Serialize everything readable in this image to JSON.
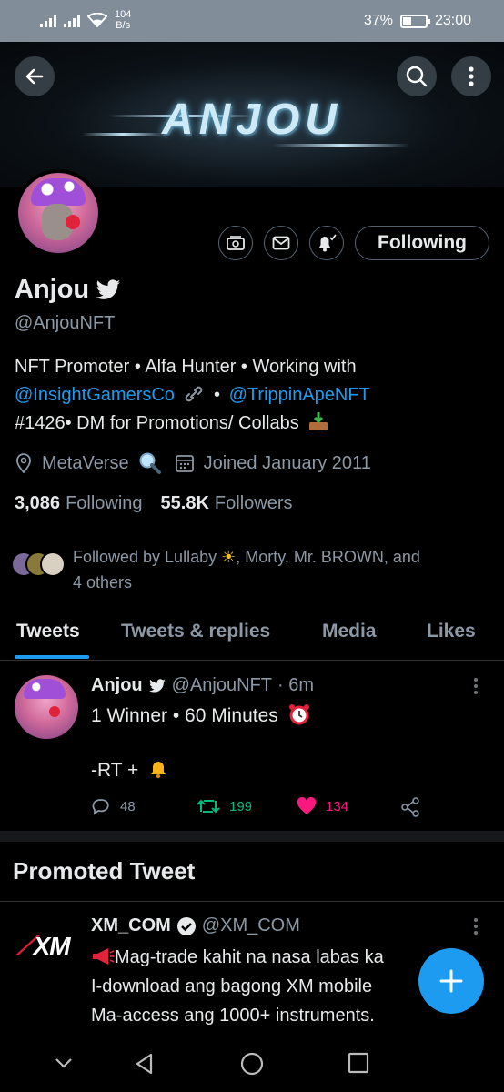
{
  "status_bar": {
    "speed_value": "104",
    "speed_unit": "B/s",
    "battery": "37%",
    "battery_level": 0.37,
    "time": "23:00"
  },
  "banner": {
    "logo_text": "ANJOU"
  },
  "profile": {
    "name": "Anjou",
    "handle": "@AnjouNFT",
    "following_button": "Following",
    "bio_line1": "NFT Promoter • Alfa Hunter • Working with",
    "bio_link1": "@InsightGamersCo",
    "bio_sep": "•",
    "bio_link2": "@TrippinApeNFT",
    "bio_line3": "#1426• DM for Promotions/ Collabs",
    "location": "MetaVerse",
    "joined": "Joined January 2011",
    "following_count": "3,086",
    "following_label": "Following",
    "followers_count": "55.8K",
    "followers_label": "Followers",
    "followed_by_1": "Followed by Lullaby",
    "followed_by_2": ", Morty, Mr. BROWN, and",
    "followed_by_3": "4 others"
  },
  "tabs": [
    {
      "label": "Tweets",
      "active": true
    },
    {
      "label": "Tweets & replies",
      "active": false
    },
    {
      "label": "Media",
      "active": false
    },
    {
      "label": "Likes",
      "active": false
    }
  ],
  "tweet": {
    "name": "Anjou",
    "handle": "@AnjouNFT",
    "time": "· 6m",
    "line1": "1 Winner • 60 Minutes",
    "line2": "-RT +",
    "replies": "48",
    "retweets": "199",
    "likes": "134"
  },
  "promoted": {
    "title": "Promoted Tweet",
    "logo": "XM",
    "name": "XM_COM",
    "handle": "@XM_COM",
    "line1": "Mag-trade kahit na nasa labas ka",
    "line2": "I-download ang bagong XM mobile",
    "line3": "Ma-access ang 1000+ instruments."
  },
  "colors": {
    "accent": "#1d9bf0",
    "retweet": "#00ba7c",
    "like": "#f91880",
    "muted": "#8b98a5"
  }
}
